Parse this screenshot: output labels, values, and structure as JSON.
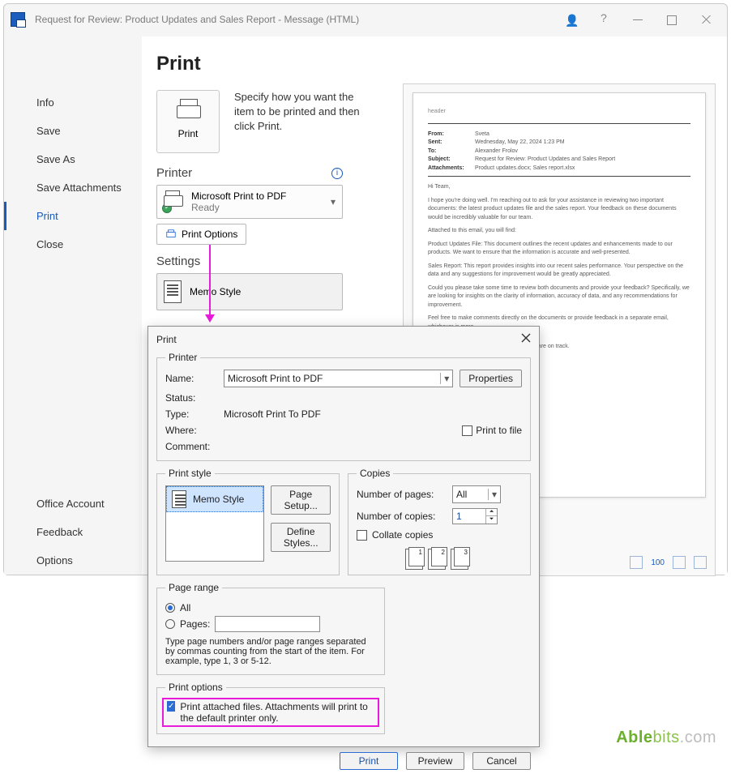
{
  "window": {
    "title": "Request for Review: Product Updates and Sales Report  -  Message (HTML)"
  },
  "sidebar": {
    "items": [
      "Info",
      "Save",
      "Save As",
      "Save Attachments",
      "Print",
      "Close"
    ],
    "bottom": [
      "Office Account",
      "Feedback",
      "Options"
    ],
    "active_index": 4
  },
  "backstage": {
    "heading": "Print",
    "print_btn_label": "Print",
    "description": "Specify how you want the item to be printed and then click Print.",
    "printer_section": "Printer",
    "printer_name": "Microsoft Print to PDF",
    "printer_status": "Ready",
    "print_options_label": "Print Options",
    "settings_section": "Settings",
    "style_name": "Memo Style"
  },
  "preview": {
    "header_label": "header",
    "meta": {
      "from_label": "From:",
      "from": "Sveta",
      "sent_label": "Sent:",
      "sent": "Wednesday, May 22, 2024 1:23 PM",
      "to_label": "To:",
      "to": "Alexander Frolov",
      "subject_label": "Subject:",
      "subject": "Request for Review: Product Updates and Sales Report",
      "attach_label": "Attachments:",
      "attach": "Product updates.docx; Sales report.xlsx"
    },
    "body": [
      "Hi Team,",
      "I hope you're doing well. I'm reaching out to ask for your assistance in reviewing two important documents: the latest product updates file and the sales report. Your feedback on these documents would be incredibly valuable for our team.",
      "Attached to this email, you will find:",
      "Product Updates File: This document outlines the recent updates and enhancements made to our products. We want to ensure that the information is accurate and well-presented.",
      "Sales Report: This report provides insights into our recent sales performance. Your perspective on the data and any suggestions for improvement would be greatly appreciated.",
      "Could you please take some time to review both documents and provide your feedback? Specifically, we are looking for insights on the clarity of information, accuracy of data, and any recommendations for improvement.",
      "Feel free to make comments directly on the documents or provide feedback in a separate email, whichever is more",
      "are up-to-date and that our sales strategies are on track."
    ],
    "zoom_percent": "100"
  },
  "dialog": {
    "title": "Print",
    "printer_legend": "Printer",
    "name_label": "Name:",
    "name_value": "Microsoft Print to PDF",
    "properties_btn": "Properties",
    "status_label": "Status:",
    "type_label": "Type:",
    "type_value": "Microsoft Print To PDF",
    "where_label": "Where:",
    "comment_label": "Comment:",
    "print_to_file": "Print to file",
    "print_style_legend": "Print style",
    "style_item": "Memo Style",
    "page_setup_btn": "Page Setup...",
    "define_styles_btn": "Define Styles...",
    "copies_legend": "Copies",
    "num_pages_label": "Number of pages:",
    "num_pages_value": "All",
    "num_copies_label": "Number of copies:",
    "num_copies_value": "1",
    "collate_label": "Collate copies",
    "collate_nums": [
      "1",
      "2",
      "3"
    ],
    "page_range_legend": "Page range",
    "all_label": "All",
    "pages_label": "Pages:",
    "range_hint": "Type page numbers and/or page ranges separated by commas counting from the start of the item.  For example, type 1, 3 or 5-12.",
    "print_options_legend": "Print options",
    "attach_option": "Print attached files.  Attachments will print to the default printer only.",
    "footer": {
      "print": "Print",
      "preview": "Preview",
      "cancel": "Cancel"
    }
  },
  "watermark": {
    "a": "Able",
    "b": "bits",
    "c": ".com"
  }
}
